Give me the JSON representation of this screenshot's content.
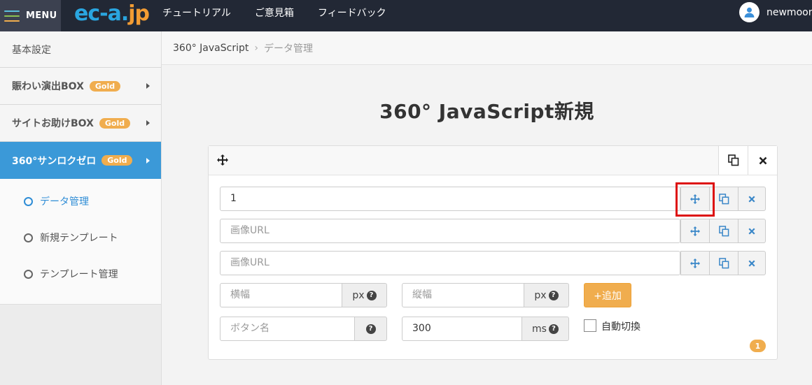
{
  "header": {
    "menu_label": "MENU",
    "logo": {
      "part1": "ec-",
      "part2": "a.",
      "part3": "jp"
    },
    "nav": [
      {
        "label": "チュートリアル"
      },
      {
        "label": "ご意見箱"
      },
      {
        "label": "フィードバック"
      }
    ],
    "username": "newmoon"
  },
  "sidebar": {
    "basic_settings": "基本設定",
    "items": [
      {
        "label": "賑わい演出BOX",
        "badge": "Gold"
      },
      {
        "label": "サイトお助けBOX",
        "badge": "Gold"
      },
      {
        "label": "360°サンロクゼロ",
        "badge": "Gold"
      }
    ],
    "sub_items": [
      {
        "label": "データ管理"
      },
      {
        "label": "新規テンプレート"
      },
      {
        "label": "テンプレート管理"
      }
    ]
  },
  "breadcrumb": {
    "root": "360° JavaScript",
    "current": "データ管理"
  },
  "page": {
    "title": "360° JavaScript新規"
  },
  "form": {
    "row1_value": "1",
    "image_url_placeholder": "画像URL",
    "width_placeholder": "横幅",
    "height_placeholder": "縦幅",
    "unit_px": "px",
    "button_name_placeholder": "ボタン名",
    "interval_value": "300",
    "unit_ms": "ms",
    "help_mark": "?",
    "add_button": "+追加",
    "auto_switch_label": "自動切換",
    "auto_switch_checked": false,
    "count": "1"
  },
  "colors": {
    "topbar": "#222835",
    "accent_blue": "#3b99d8",
    "gold": "#f0ad4e",
    "highlight_red": "#dd1111"
  }
}
